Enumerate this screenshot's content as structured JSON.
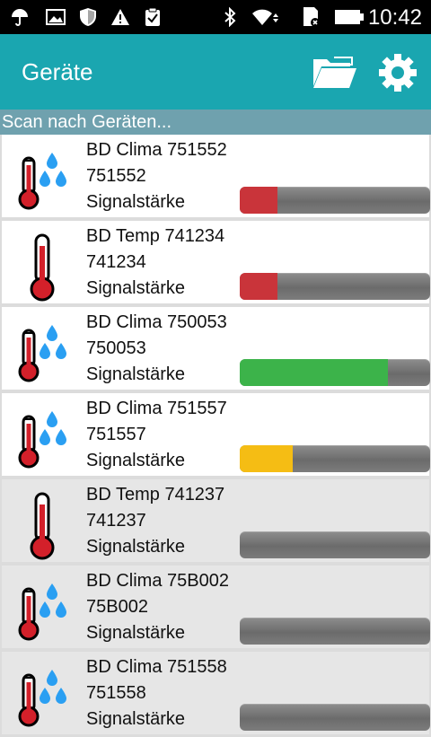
{
  "status_bar": {
    "time": "10:42"
  },
  "app_bar": {
    "title": "Geräte"
  },
  "scan": {
    "status_text": "Scan nach Geräten..."
  },
  "colors": {
    "app_bar": "#1aa6b0",
    "scan_bar": "#6fa1ae",
    "signal_weak": "#c9343a",
    "signal_good": "#3cb34a",
    "signal_medium": "#f5bd14",
    "signal_track": "#7a7a7a"
  },
  "devices": [
    {
      "name": "BD Clima 751552",
      "id": "751552",
      "signal_label": "Signalstärke",
      "type": "clima",
      "signal": 0.2,
      "signal_color": "#c9343a",
      "active": true
    },
    {
      "name": "BD Temp 741234",
      "id": "741234",
      "signal_label": "Signalstärke",
      "type": "temp",
      "signal": 0.2,
      "signal_color": "#c9343a",
      "active": true
    },
    {
      "name": "BD Clima 750053",
      "id": "750053",
      "signal_label": "Signalstärke",
      "type": "clima",
      "signal": 0.78,
      "signal_color": "#3cb34a",
      "active": true
    },
    {
      "name": "BD Clima 751557",
      "id": "751557",
      "signal_label": "Signalstärke",
      "type": "clima",
      "signal": 0.28,
      "signal_color": "#f5bd14",
      "active": true
    },
    {
      "name": "BD Temp 741237",
      "id": "741237",
      "signal_label": "Signalstärke",
      "type": "temp",
      "signal": 0,
      "signal_color": "#7a7a7a",
      "active": false
    },
    {
      "name": "BD Clima 75B002",
      "id": "75B002",
      "signal_label": "Signalstärke",
      "type": "clima",
      "signal": 0,
      "signal_color": "#7a7a7a",
      "active": false
    },
    {
      "name": "BD Clima 751558",
      "id": "751558",
      "signal_label": "Signalstärke",
      "type": "clima",
      "signal": 0,
      "signal_color": "#7a7a7a",
      "active": false
    }
  ]
}
